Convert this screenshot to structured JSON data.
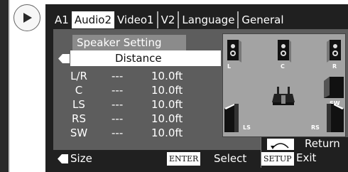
{
  "tabs": [
    {
      "label": "A1",
      "active": false
    },
    {
      "label": "Audio2",
      "active": true
    },
    {
      "label": "Video1",
      "active": false
    },
    {
      "label": "V2",
      "active": false
    },
    {
      "label": "Language",
      "active": false
    },
    {
      "label": "General",
      "active": false
    }
  ],
  "panel": {
    "title": "Speaker Setting",
    "selected_item": "Distance"
  },
  "rows": [
    {
      "channel": "L/R",
      "dash": "---",
      "value": "10.0ft"
    },
    {
      "channel": "C",
      "dash": "---",
      "value": "10.0ft"
    },
    {
      "channel": "LS",
      "dash": "---",
      "value": "10.0ft"
    },
    {
      "channel": "RS",
      "dash": "---",
      "value": "10.0ft"
    },
    {
      "channel": "SW",
      "dash": "---",
      "value": "10.0ft"
    }
  ],
  "diagram": {
    "labels": {
      "l": "L",
      "c": "C",
      "r": "R",
      "sw": "SW",
      "ls": "LS",
      "rs": "RS"
    }
  },
  "footer": {
    "size_label": "Size",
    "enter_key": "ENTER",
    "select_label": "Select",
    "return_label": "Return",
    "setup_key": "SETUP",
    "exit_label": "Exit"
  },
  "colors": {
    "osd_bg": "#202020",
    "panel_bg": "#5d5d5d",
    "diagram_bg": "#a3a3a3",
    "highlight": "#ffffff"
  }
}
